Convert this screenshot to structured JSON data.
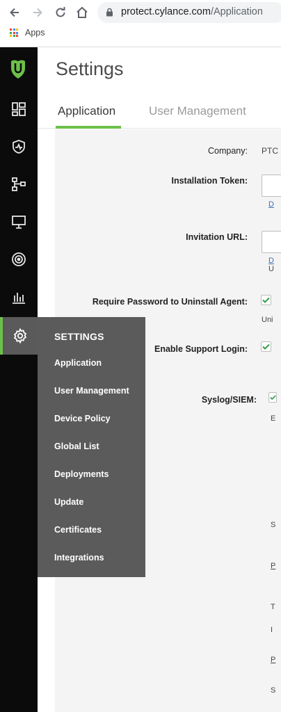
{
  "browser": {
    "url_host": "protect.cylance.com",
    "url_path": "/Application",
    "bookmarks": {
      "apps_label": "Apps"
    },
    "icons": [
      "back-icon",
      "forward-icon",
      "reload-icon",
      "home-icon",
      "lock-icon",
      "apps-grid-icon"
    ]
  },
  "header": {
    "title": "Settings"
  },
  "tabs": [
    {
      "label": "Application",
      "active": true
    },
    {
      "label": "User Management",
      "active": false
    }
  ],
  "rail": {
    "icons": [
      "cylance-logo",
      "dashboard-icon",
      "protection-icon",
      "zones-icon",
      "devices-icon",
      "threat-radar-icon",
      "reports-icon",
      "settings-icon"
    ],
    "active": "settings-icon",
    "accent_color": "#6cc04a"
  },
  "flyout": {
    "title": "SETTINGS",
    "items": [
      "Application",
      "User Management",
      "Device Policy",
      "Global List",
      "Deployments",
      "Update",
      "Certificates",
      "Integrations"
    ]
  },
  "form": {
    "company": {
      "label": "Company:",
      "value": "PTC"
    },
    "installation_token": {
      "label": "Installation Token:",
      "link": "D"
    },
    "invitation_url": {
      "label": "Invitation URL:",
      "link": "D",
      "note": "U"
    },
    "require_password": {
      "label": "Require Password to Uninstall Agent:",
      "checked": true,
      "note": "Uni"
    },
    "support_login": {
      "label": "Enable Support Login:",
      "checked": true
    },
    "syslog": {
      "label": "Syslog/SIEM:",
      "checked": true,
      "note": "E"
    },
    "truncated_labels": [
      "S",
      "P",
      "T",
      "I",
      "P",
      "S"
    ]
  }
}
